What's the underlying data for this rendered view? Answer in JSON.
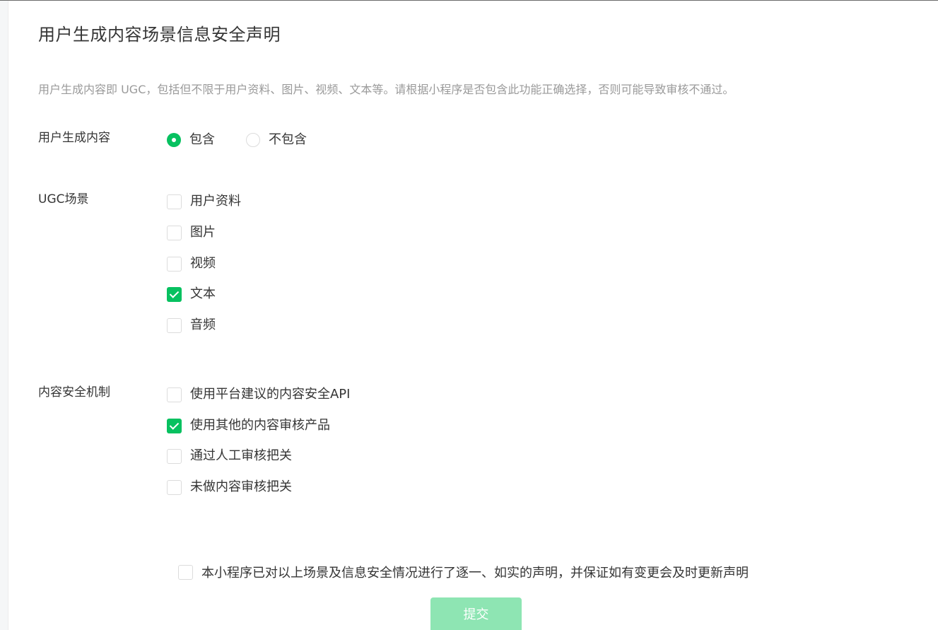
{
  "page": {
    "title": "用户生成内容场景信息安全声明",
    "description": "用户生成内容即 UGC，包括但不限于用户资料、图片、视频、文本等。请根据小程序是否包含此功能正确选择，否则可能导致审核不通过。"
  },
  "ugc_contains": {
    "label": "用户生成内容",
    "options": [
      {
        "label": "包含",
        "selected": true
      },
      {
        "label": "不包含",
        "selected": false
      }
    ]
  },
  "ugc_scenes": {
    "label": "UGC场景",
    "options": [
      {
        "label": "用户资料",
        "checked": false
      },
      {
        "label": "图片",
        "checked": false
      },
      {
        "label": "视频",
        "checked": false
      },
      {
        "label": "文本",
        "checked": true
      },
      {
        "label": "音频",
        "checked": false
      }
    ]
  },
  "security_mechanism": {
    "label": "内容安全机制",
    "options": [
      {
        "label": "使用平台建议的内容安全API",
        "checked": false
      },
      {
        "label": "使用其他的内容审核产品",
        "checked": true
      },
      {
        "label": "通过人工审核把关",
        "checked": false
      },
      {
        "label": "未做内容审核把关",
        "checked": false
      }
    ]
  },
  "declaration": {
    "label": "本小程序已对以上场景及信息安全情况进行了逐一、如实的声明，并保证如有变更会及时更新声明",
    "checked": false
  },
  "submit": {
    "label": "提交",
    "disabled": true
  },
  "colors": {
    "accent": "#07c160",
    "accent_disabled": "#8ee5b3",
    "text_primary": "#353535",
    "text_secondary": "#9a9a9a"
  }
}
